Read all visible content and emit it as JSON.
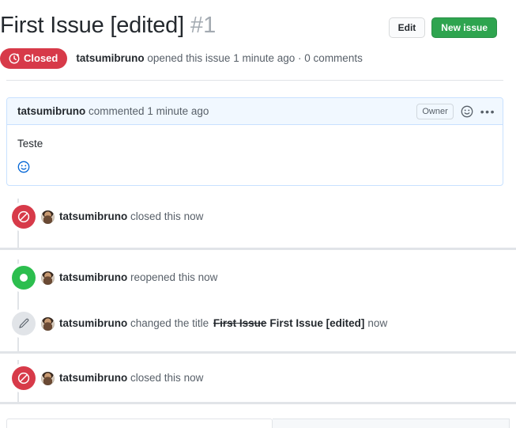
{
  "header": {
    "title": "First Issue [edited]",
    "issue_number": "#1",
    "edit_label": "Edit",
    "new_issue_label": "New issue",
    "accent_green": "#2ea44f",
    "accent_red": "#d73a49"
  },
  "state": {
    "badge_label": "Closed",
    "badge_icon": "issue-closed-icon",
    "meta_author": "tatsumibruno",
    "meta_action": "opened this issue",
    "meta_time": "1 minute ago",
    "meta_separator": "·",
    "meta_comments": "0 comments"
  },
  "comment": {
    "author": "tatsumibruno",
    "action": "commented",
    "time": "1 minute ago",
    "owner_badge": "Owner",
    "reaction_icon": "smiley-icon",
    "menu_icon": "kebab-horizontal-icon",
    "body_text": "Teste",
    "add_reaction_icon": "smiley-plus-icon",
    "header_bg": "#f1f8ff",
    "border_color": "#c8e1ff"
  },
  "timeline": [
    {
      "type": "closed",
      "icon": "circle-slash-icon",
      "badge_color": "#d73a49",
      "author": "tatsumibruno",
      "text": "closed this",
      "time": "now"
    },
    {
      "type": "reopened",
      "icon": "dot-icon",
      "badge_color": "#2cbe4e",
      "author": "tatsumibruno",
      "text": "reopened this",
      "time": "now"
    },
    {
      "type": "renamed",
      "icon": "pencil-icon",
      "badge_color": "#e1e4e8",
      "author": "tatsumibruno",
      "text": "changed the title",
      "old_title": "First Issue",
      "new_title": "First Issue [edited]",
      "time": "now"
    },
    {
      "type": "closed",
      "icon": "circle-slash-icon",
      "badge_color": "#d73a49",
      "author": "tatsumibruno",
      "text": "closed this",
      "time": "now"
    }
  ]
}
